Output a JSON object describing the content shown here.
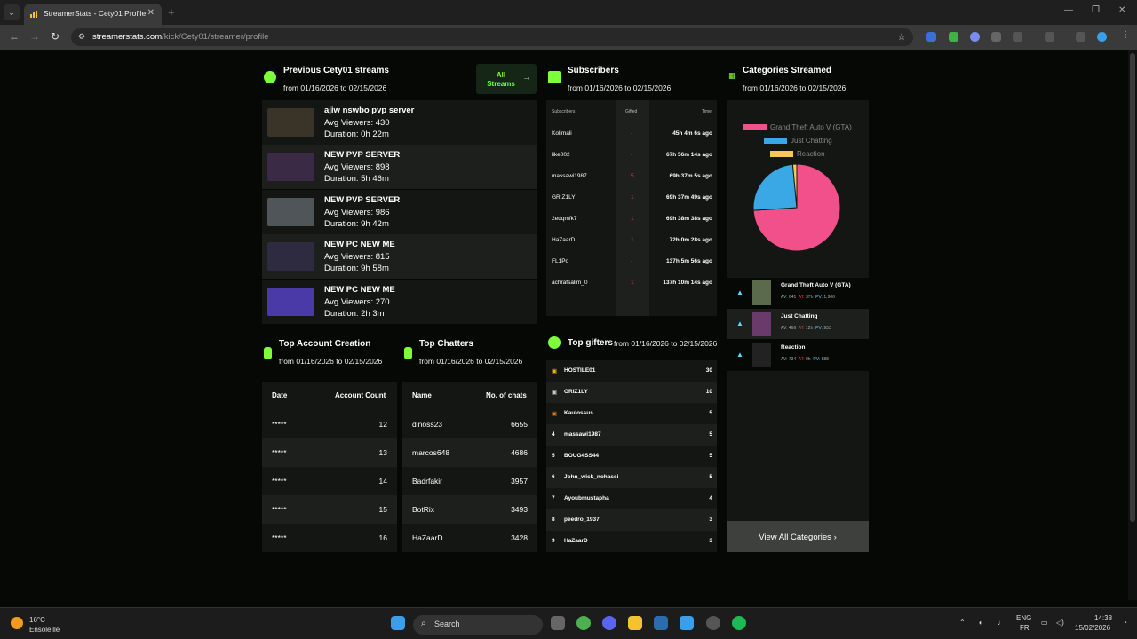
{
  "browser": {
    "tab_title": "StreamerStats - Cety01 Profile",
    "url_host": "streamerstats.com",
    "url_path": "/kick/Cety01/streamer/profile"
  },
  "streams": {
    "title": "Previous Cety01 streams",
    "range": "from 01/16/2026 to 02/15/2026",
    "all_button": "All Streams",
    "items": [
      {
        "title": "ajiw nswbo pvp server",
        "viewers": "Avg Viewers: 430",
        "duration": "Duration: 0h 22m"
      },
      {
        "title": "NEW PVP SERVER",
        "viewers": "Avg Viewers: 898",
        "duration": "Duration: 5h 46m"
      },
      {
        "title": "NEW PVP SERVER",
        "viewers": "Avg Viewers: 986",
        "duration": "Duration: 9h 42m"
      },
      {
        "title": "NEW PC NEW ME",
        "viewers": "Avg Viewers: 815",
        "duration": "Duration: 9h 58m"
      },
      {
        "title": "NEW PC NEW ME",
        "viewers": "Avg Viewers: 270",
        "duration": "Duration: 2h 3m"
      }
    ]
  },
  "account": {
    "title": "Top Account Creation",
    "range": "from 01/16/2026 to 02/15/2026",
    "headers": [
      "Date",
      "Account Count"
    ],
    "rows": [
      [
        "*****",
        "12"
      ],
      [
        "*****",
        "13"
      ],
      [
        "*****",
        "14"
      ],
      [
        "*****",
        "15"
      ],
      [
        "*****",
        "16"
      ]
    ]
  },
  "chatters": {
    "title": "Top Chatters",
    "range": "from 01/16/2026 to 02/15/2026",
    "headers": [
      "Name",
      "No. of chats"
    ],
    "rows": [
      [
        "dinoss23",
        "6655"
      ],
      [
        "marcos648",
        "4686"
      ],
      [
        "Badrfakir",
        "3957"
      ],
      [
        "BotRix",
        "3493"
      ],
      [
        "HaZaarD",
        "3428"
      ]
    ]
  },
  "subscribers": {
    "title": "Subscribers",
    "range": "from 01/16/2026 to 02/15/2026",
    "headers": [
      "Subscribers",
      "Gifted",
      "Time"
    ],
    "rows": [
      [
        "Kolimali",
        "-",
        "45h 4m 6s ago"
      ],
      [
        "like002",
        "-",
        "67h 56m 14s ago"
      ],
      [
        "massawi1987",
        "5",
        "69h 37m 5s ago"
      ],
      [
        "GRIZ1LY",
        "1",
        "69h 37m 49s ago"
      ],
      [
        "2edqmfk7",
        "1",
        "69h 38m 38s ago"
      ],
      [
        "HaZaarD",
        "1",
        "72h 0m 28s ago"
      ],
      [
        "FL1Po",
        "-",
        "137h 5m 56s ago"
      ],
      [
        "achrafsalim_0",
        "1",
        "137h 10m 14s ago"
      ]
    ]
  },
  "gifters": {
    "title": "Top gifters",
    "range": "from 01/16/2026 to 02/15/2026",
    "rows": [
      [
        "",
        "HOSTILE01",
        "30"
      ],
      [
        "",
        "GRIZ1LY",
        "10"
      ],
      [
        "",
        "Kaulossus",
        "5"
      ],
      [
        "4",
        "massawi1987",
        "5"
      ],
      [
        "5",
        "BOUG4SS44",
        "5"
      ],
      [
        "6",
        "John_wick_nohassi",
        "5"
      ],
      [
        "7",
        "Ayoubmustapha",
        "4"
      ],
      [
        "8",
        "peedro_1937",
        "3"
      ],
      [
        "9",
        "HaZaarD",
        "3"
      ]
    ]
  },
  "categories": {
    "title": "Categories Streamed",
    "range": "from 01/16/2026 to 02/15/2026",
    "legend": [
      "Grand Theft Auto V (GTA)",
      "Just Chatting",
      "Reaction"
    ],
    "colors": [
      "#f2508a",
      "#3ba8e6",
      "#f4c75a"
    ],
    "chart_data": {
      "type": "pie",
      "categories": [
        "Grand Theft Auto V (GTA)",
        "Just Chatting",
        "Reaction"
      ],
      "values": [
        74,
        24.5,
        1.5
      ],
      "title": ""
    },
    "items": [
      {
        "name": "Grand Theft Auto V (GTA)",
        "av": "641",
        "at": "37h",
        "pv": "1,906"
      },
      {
        "name": "Just Chatting",
        "av": "466",
        "at": "12h",
        "pv": "953"
      },
      {
        "name": "Reaction",
        "av": "734",
        "at": "0h",
        "pv": "888"
      }
    ],
    "view_all": "View All Categories"
  },
  "taskbar": {
    "temp": "16°C",
    "weather": "Ensoleillé",
    "search": "Search",
    "lang1": "ENG",
    "lang2": "FR",
    "time": "14:38",
    "date": "15/02/2026"
  }
}
